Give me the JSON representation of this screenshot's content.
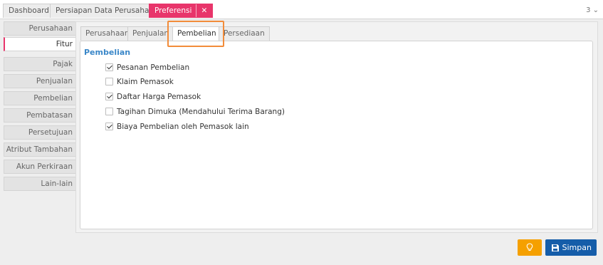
{
  "top_tabs": {
    "dashboard": "Dashboard",
    "persiapan": "Persiapan Data Perusahaan",
    "preferensi": "Preferensi",
    "counter": "3 ⌄"
  },
  "sidebar": {
    "items": [
      {
        "label": "Perusahaan"
      },
      {
        "label": "Fitur",
        "active": true
      },
      {
        "label": "Pajak"
      },
      {
        "label": "Penjualan"
      },
      {
        "label": "Pembelian"
      },
      {
        "label": "Pembatasan"
      },
      {
        "label": "Persetujuan"
      },
      {
        "label": "Atribut Tambahan"
      },
      {
        "label": "Akun Perkiraan"
      },
      {
        "label": "Lain-lain"
      }
    ]
  },
  "sub_tabs": {
    "perusahaan": "Perusahaan",
    "penjualan": "Penjualan",
    "pembelian": "Pembelian",
    "persediaan": "Persediaan",
    "active": "Pembelian"
  },
  "section": {
    "title": "Pembelian",
    "options": [
      {
        "label": "Pesanan Pembelian",
        "checked": true
      },
      {
        "label": "Klaim Pemasok",
        "checked": false
      },
      {
        "label": "Daftar Harga Pemasok",
        "checked": true
      },
      {
        "label": "Tagihan Dimuka (Mendahului Terima Barang)",
        "checked": false
      },
      {
        "label": "Biaya Pembelian oleh Pemasok lain",
        "checked": true
      }
    ]
  },
  "buttons": {
    "save": "Simpan",
    "bulb_icon": "lightbulb-icon",
    "save_icon": "floppy-disk-icon"
  },
  "colors": {
    "accent": "#e8356b",
    "section_title": "#3a87c8",
    "save_button": "#155da9",
    "bulb_button": "#f5a000",
    "highlight": "#f28c3a"
  }
}
